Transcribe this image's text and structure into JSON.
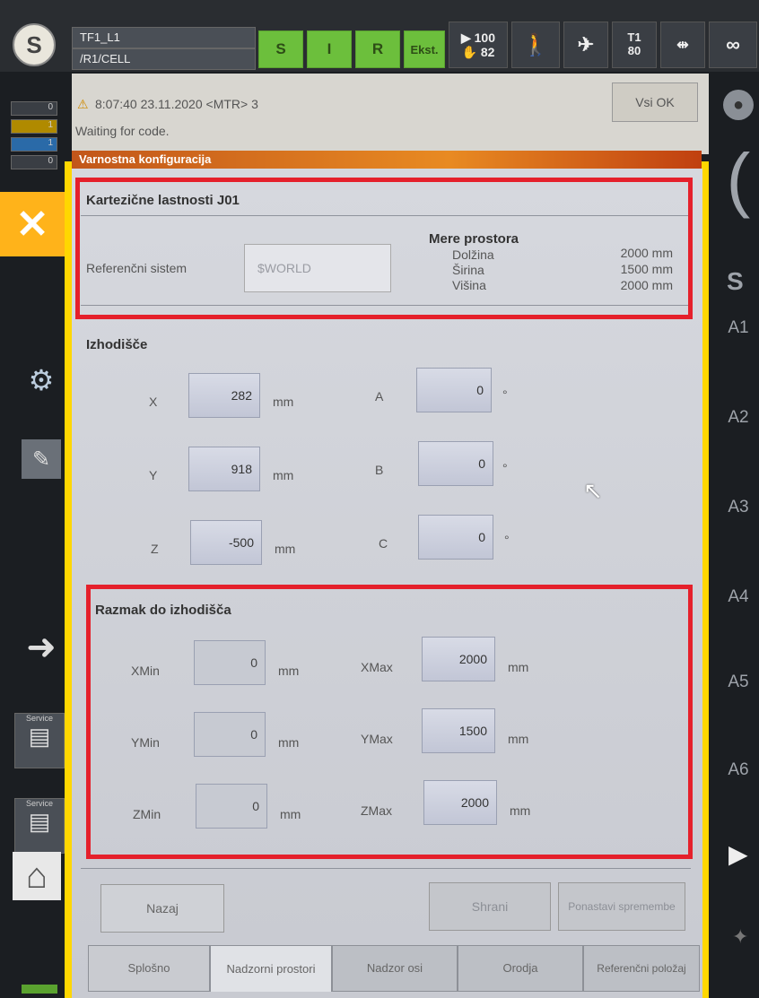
{
  "header": {
    "line1": "TF1_L1",
    "line2": "/R1/CELL",
    "mode_buttons": [
      "S",
      "I",
      "R",
      "Ekst."
    ],
    "override_top": "100",
    "override_bottom": "82",
    "t1_top": "T1",
    "t1_bottom": "80",
    "infinity": "∞"
  },
  "message": {
    "timestamp": "8:07:40 23.11.2020 <MTR> 3",
    "text": "Waiting for code.",
    "ack_button": "Vsi OK"
  },
  "left_indicators": [
    "0",
    "1",
    "1",
    "0"
  ],
  "window": {
    "title": "Varnostna konfiguracija"
  },
  "properties": {
    "heading": "Kartezične lastnosti J01",
    "ref_label": "Referenčni sistem",
    "ref_value": "$WORLD",
    "space_heading": "Mere prostora",
    "dims": [
      {
        "label": "Dolžina",
        "value": "2000 mm"
      },
      {
        "label": "Širina",
        "value": "1500 mm"
      },
      {
        "label": "Višina",
        "value": "2000 mm"
      }
    ]
  },
  "origin": {
    "heading": "Izhodišče",
    "rows": [
      {
        "l1": "X",
        "v1": "282",
        "u1": "mm",
        "l2": "A",
        "v2": "0",
        "u2": "°"
      },
      {
        "l1": "Y",
        "v1": "918",
        "u1": "mm",
        "l2": "B",
        "v2": "0",
        "u2": "°"
      },
      {
        "l1": "Z",
        "v1": "-500",
        "u1": "mm",
        "l2": "C",
        "v2": "0",
        "u2": "°"
      }
    ]
  },
  "distance": {
    "heading": "Razmak do izhodišča",
    "rows": [
      {
        "l1": "XMin",
        "v1": "0",
        "u1": "mm",
        "l2": "XMax",
        "v2": "2000",
        "u2": "mm"
      },
      {
        "l1": "YMin",
        "v1": "0",
        "u1": "mm",
        "l2": "YMax",
        "v2": "1500",
        "u2": "mm"
      },
      {
        "l1": "ZMin",
        "v1": "0",
        "u1": "mm",
        "l2": "ZMax",
        "v2": "2000",
        "u2": "mm"
      }
    ]
  },
  "actions": {
    "back": "Nazaj",
    "save": "Shrani",
    "reset": "Ponastavi spremembe"
  },
  "tabs": [
    "Splošno",
    "Nadzorni prostori",
    "Nadzor osi",
    "Orodja",
    "Referenčni položaj"
  ],
  "service_label": "Service",
  "axes": [
    "A1",
    "A2",
    "A3",
    "A4",
    "A5",
    "A6"
  ]
}
